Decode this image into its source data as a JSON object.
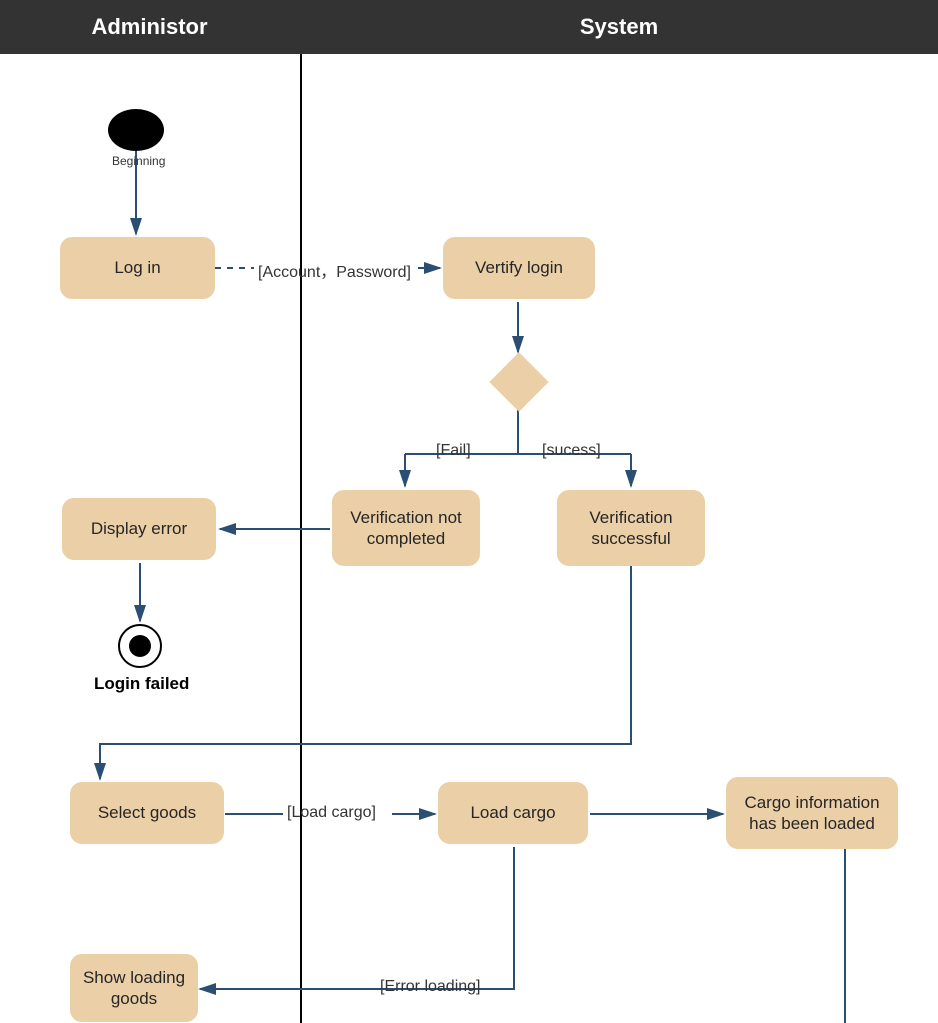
{
  "lanes": {
    "left": "Administor",
    "right": "System"
  },
  "nodes": {
    "beginning": "Beginning",
    "login": "Log in",
    "account_password": "[Account，Password]",
    "verify_login": "Vertify login",
    "fail": "[Fail]",
    "success": "[sucess]",
    "verification_not_completed": "Verification not completed",
    "verification_successful": "Verification successful",
    "display_error": "Display error",
    "login_failed": "Login failed",
    "select_goods": "Select goods",
    "load_cargo_label": "[Load cargo]",
    "load_cargo": "Load cargo",
    "cargo_loaded": "Cargo information has been loaded",
    "error_loading": "[Error loading]",
    "show_loading_goods": "Show loading goods"
  },
  "colors": {
    "node_fill": "#ebcfa7",
    "arrow": "#2b4f72",
    "header_bg": "#333333"
  }
}
